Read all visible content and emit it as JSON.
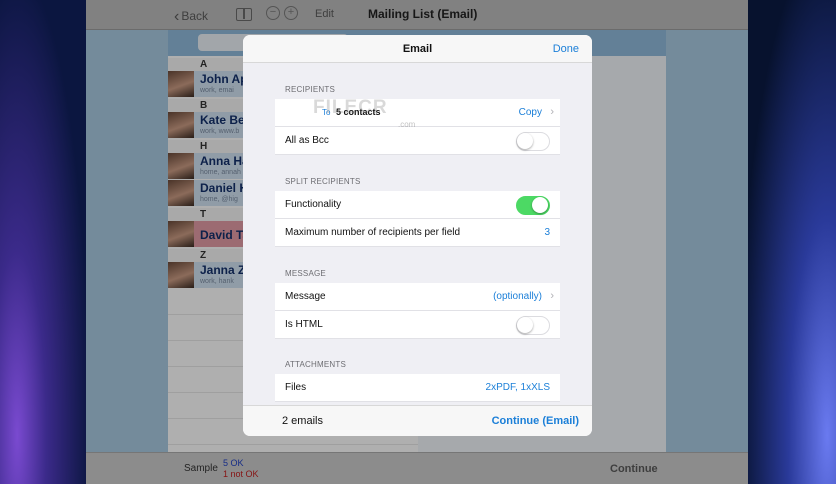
{
  "navbar": {
    "back_label": "Back",
    "edit_label": "Edit",
    "title": "Mailing List (Email)"
  },
  "contacts": {
    "sections": [
      "A",
      "B",
      "H",
      "T",
      "Z"
    ],
    "rows": [
      {
        "name": "John Ap",
        "sub": "work, emai"
      },
      {
        "name": "Kate Be",
        "sub": "work, www.b"
      },
      {
        "name": "Anna Ha",
        "sub": "home, annah"
      },
      {
        "name": "Daniel H",
        "sub": "home, @hig"
      },
      {
        "name": "David Ta",
        "sub": ""
      },
      {
        "name": "Janna Z",
        "sub": "work, hank"
      }
    ]
  },
  "toolbar": {
    "sample_label": "Sample",
    "ok_label": "5 OK",
    "not_ok_label": "1 not OK",
    "continue_label": "Continue"
  },
  "modal": {
    "title": "Email",
    "done_label": "Done",
    "recipients": {
      "header": "RECIPIENTS",
      "to_label": "To",
      "to_value": "5 contacts",
      "copy_label": "Copy",
      "bcc_label": "All as Bcc",
      "bcc_on": false
    },
    "split": {
      "header": "SPLIT RECIPIENTS",
      "functionality_label": "Functionality",
      "functionality_on": true,
      "max_label": "Maximum number of recipients per field",
      "max_value": "3"
    },
    "message": {
      "header": "MESSAGE",
      "message_label": "Message",
      "message_value": "(optionally)",
      "html_label": "Is HTML",
      "html_on": false
    },
    "attachments": {
      "header": "ATTACHMENTS",
      "files_label": "Files",
      "files_value": "2xPDF, 1xXLS"
    },
    "footer": {
      "count_label": "2 emails",
      "continue_label": "Continue (Email)"
    }
  },
  "watermark": {
    "main": "FILECR",
    "suffix": ".com"
  },
  "colors": {
    "accent": "#1b7fd8",
    "toggle_on": "#4cd964",
    "ok": "#2040c0",
    "not_ok": "#c02020"
  }
}
